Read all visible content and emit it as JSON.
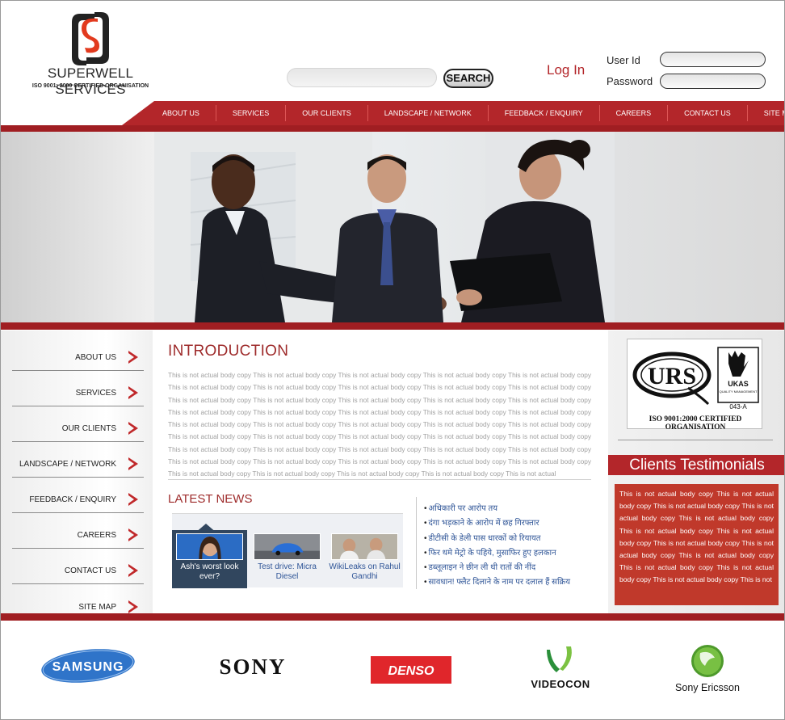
{
  "brand": {
    "name": "SUPERWELL SERVICES",
    "tagline": "ISO 9001: 2000 CERTIFIED ORGANISATION"
  },
  "search": {
    "button_label": "SEARCH",
    "placeholder": ""
  },
  "login": {
    "link_label": "Log In",
    "userid_label": "User Id",
    "password_label": "Password"
  },
  "nav": {
    "items": [
      "ABOUT US",
      "SERVICES",
      "OUR CLIENTS",
      "LANDSCAPE / NETWORK",
      "FEEDBACK / ENQUIRY",
      "CAREERS",
      "CONTACT US",
      "SITE MAP"
    ]
  },
  "sidebar": {
    "items": [
      "ABOUT US",
      "SERVICES",
      "OUR CLIENTS",
      "LANDSCAPE / NETWORK",
      "FEEDBACK / ENQUIRY",
      "CAREERS",
      "CONTACT US",
      "SITE MAP"
    ]
  },
  "intro": {
    "title": "INTRODUCTION",
    "body": "This is not actual body copy This is not actual body copy This is not actual body copy This is not actual body copy This is not actual body copy This is not actual body copy This is not actual body copy This is not actual body copy This is not actual body copy This is not actual body copy This is not actual body copy This is not actual body copy This is not actual body copy This is not actual body copy This is not actual body copy This is not actual body copy This is not actual body copy This is not actual body copy This is not actual body copy This is not actual body copy This is not actual body copy This is not actual body copy This is not actual body copy This is not actual body copy This is not actual body copy This is not actual body copy This is not actual body copy This is not actual body copy This is not actual body copy This is not actual body copy This is not actual body copy This is not actual body copy This is not actual body copy This is not actual body copy This is not actual body copy This is not actual body copy This is not actual body copy This is not actual body copy This is not actual body copy This is not actual body copy This is not actual body copy This is not actual body copy This is not actual body copy This is not actual body copy This is not actual"
  },
  "news": {
    "title": "LATEST NEWS",
    "cards": [
      {
        "caption": "Ash's worst look ever?"
      },
      {
        "caption": "Test drive: Micra Diesel"
      },
      {
        "caption": "WikiLeaks on Rahul Gandhi"
      }
    ],
    "headlines": [
      "अधिकारी पर आरोप तय",
      "दंगा भड़काने के आरोप में छह गिरफ्तार",
      "डीटीसी के डेली पास धारकों को रियायत",
      "फिर थमे मेट्रो के पहिये, मुसाफिर हुए हलकान",
      "डब्लूलाइन ने छीन ली थी रातों की नींद",
      "सावधान! फ्लैट दिलाने के नाम पर दलाल हैं सक्रिय"
    ]
  },
  "certificate": {
    "urs": "URS",
    "ukas": "UKAS",
    "ukas_sub": "QUALITY MANAGEMENT",
    "code": "043-A",
    "caption": "ISO 9001:2000 CERTIFIED ORGANISATION"
  },
  "testimonials": {
    "title": "Clients Testimonials",
    "body": "This is not actual body copy This is not actual body copy This is not actual body copy This is not actual body copy This is not actual body copy This is not actual body copy This is not actual body copy This is not actual body copy This is not actual body copy This is not actual body copy This is not actual body copy This is not actual body copy This is not actual body copy This is not"
  },
  "clients": {
    "samsung": "SAMSUNG",
    "sony": "SONY",
    "denso": "DENSO",
    "videocon": "VIDEOCON",
    "sony_ericsson": "Sony Ericsson"
  },
  "colors": {
    "accent_red": "#b3262a",
    "dark_red": "#a01e22",
    "link_blue": "#2f5597"
  }
}
